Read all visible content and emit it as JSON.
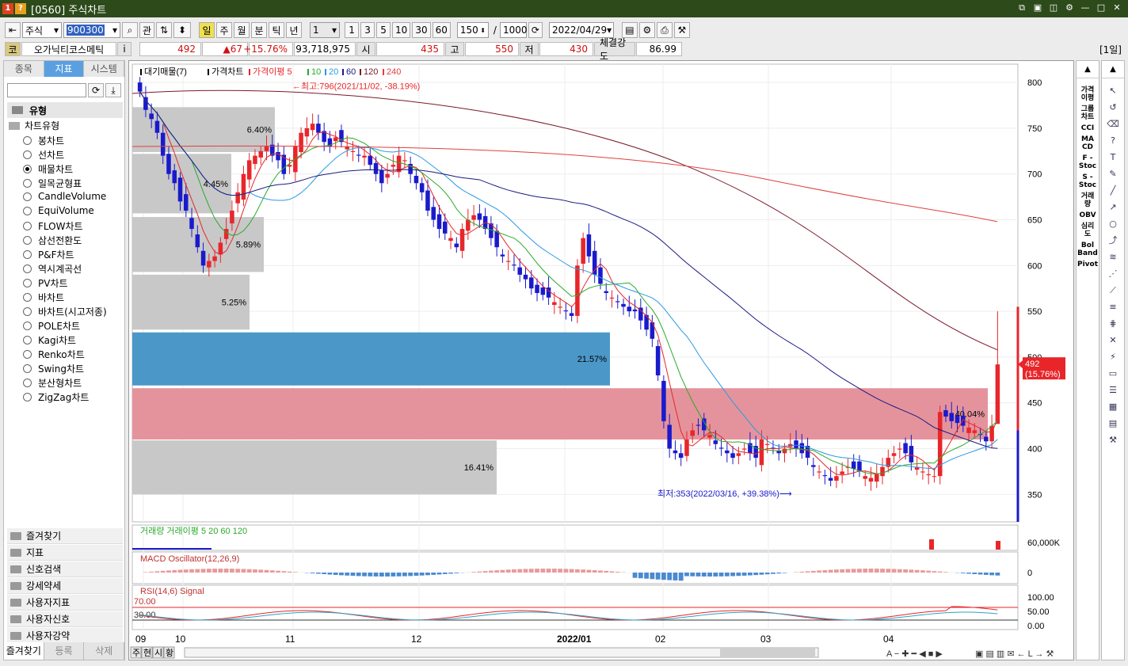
{
  "window": {
    "title": "[0560] 주식차트",
    "badge1": "1",
    "badge2": "?"
  },
  "toolbar": {
    "market": "주식",
    "code": "900300",
    "btn_gwan": "관",
    "periods": [
      "일",
      "주",
      "월",
      "분",
      "틱",
      "년"
    ],
    "unit_value": "1",
    "quick": [
      "1",
      "3",
      "5",
      "10",
      "30",
      "60"
    ],
    "count": "150",
    "separator": "/",
    "max": "1000",
    "date": "2022/04/29"
  },
  "quote": {
    "sector": "코",
    "name": "오가닉티코스메틱",
    "info_btn": "i",
    "price": "492",
    "change": "▲67",
    "rate": "+15.76%",
    "volume": "93,718,975",
    "open_label": "시",
    "open": "435",
    "high_label": "고",
    "high": "550",
    "low_label": "저",
    "low": "430",
    "strength_label": "체결강도",
    "strength": "86.99",
    "period_tag": "[1일]"
  },
  "left": {
    "tabs": [
      "종목",
      "지표",
      "시스템"
    ],
    "section": "유형",
    "group": "차트유형",
    "types": [
      "봉차트",
      "선차트",
      "매물차트",
      "일목균형표",
      "CandleVolume",
      "EquiVolume",
      "FLOW차트",
      "삼선전환도",
      "P&F차트",
      "역시계곡선",
      "PV차트",
      "바차트",
      "바차트(시고저종)",
      "POLE차트",
      "Kagi차트",
      "Renko차트",
      "Swing차트",
      "분산형차트",
      "ZigZag차트"
    ],
    "selected": 2,
    "folders": [
      "즐겨찾기",
      "지표",
      "신호검색",
      "강세약세",
      "사용자지표",
      "사용자신호",
      "사용자강약"
    ],
    "bottom_tabs": [
      "즐겨찾기",
      "등록",
      "삭제"
    ]
  },
  "chart": {
    "legend_main": [
      "대기매물(7)",
      "가격차트",
      "가격이평 5",
      "10",
      "20",
      "60",
      "120",
      "240"
    ],
    "legend_vol": [
      "거래량",
      "거래이평 5",
      "20",
      "60",
      "120"
    ],
    "legend_macd": "MACD Oscillator(12,26,9)",
    "legend_rsi": [
      "RSI(14,6)",
      "Signal"
    ],
    "y_ticks": [
      "800",
      "750",
      "700",
      "650",
      "600",
      "550",
      "500",
      "450",
      "400",
      "350"
    ],
    "vol_tick": "60,000K",
    "macd_tick": "0",
    "rsi_ticks": [
      "100.00",
      "50.00",
      "0.00"
    ],
    "rsi_levels": [
      "70.00",
      "30.00"
    ],
    "x_ticks": [
      "09",
      "10",
      "11",
      "12",
      "2022/01",
      "02",
      "03",
      "04"
    ],
    "annot_high": "←최고:796(2021/11/02, -38.19%)",
    "annot_low": "최저:353(2022/03/16, +39.38%)⟶",
    "last_price": "492",
    "last_rate": "(15.76%)",
    "profile_pcts": [
      "6.40%",
      "4.45%",
      "5.89%",
      "5.25%",
      "21.57%",
      "40.04%",
      "16.41%"
    ]
  },
  "bottombar": [
    "주",
    "현",
    "시",
    "황"
  ],
  "colors": {
    "up": "#e8262a",
    "down": "#1a1acc",
    "ma5": "#e8262a",
    "ma10": "#2aaa2a",
    "ma20": "#2a9ae0",
    "ma60": "#1a1a80",
    "ma120": "#7a1a2a",
    "ma240": "#e04040"
  }
}
